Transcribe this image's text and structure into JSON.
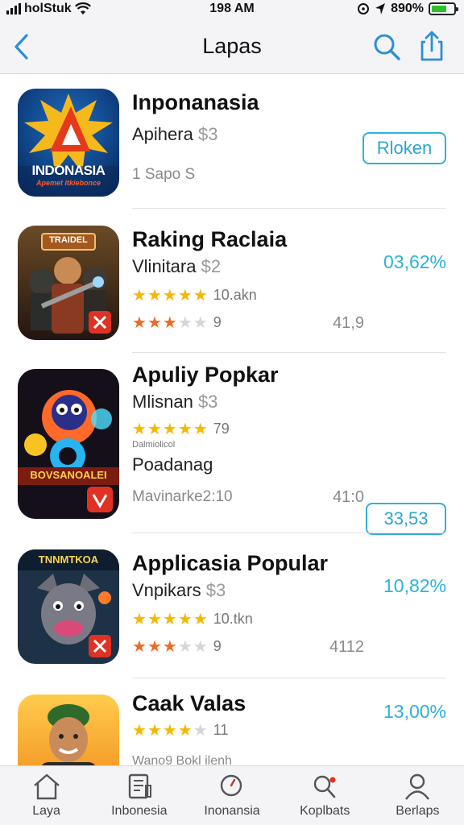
{
  "status_bar": {
    "carrier": "holStuk",
    "time": "198 AM",
    "battery": "890%",
    "battery_level_percent": 70
  },
  "nav": {
    "title": "Lapas"
  },
  "apps": [
    {
      "name": "Inponanasia",
      "subtitle": "Apihera",
      "price": "$3",
      "meta": "1 Sapo S",
      "button_label": "Rloken",
      "icon_text": "INDONASIA",
      "icon_subtext": "Apemet itkiebonce",
      "icon_colors": [
        "#0b4c9a",
        "#e43a1b",
        "#f6c323"
      ]
    },
    {
      "name": "Raking Raclaia",
      "subtitle": "Vlinitara",
      "price": "$2",
      "stars_yellow": {
        "filled": 5,
        "count_label": "10.akn"
      },
      "stars_red": {
        "filled": 3,
        "count_label": "9"
      },
      "right_value": "03,62%",
      "small_value": "41,9",
      "icon_text": "TRAIDEL",
      "icon_colors": [
        "#3b2a1a",
        "#c3782a",
        "#e03224"
      ]
    },
    {
      "name": "Apuliy Popkar",
      "subtitle": "Mlisnan",
      "price": "$3",
      "stars_yellow": {
        "filled": 5,
        "count_label": "79"
      },
      "tiny_text": "Dalmiolicol",
      "secondary_text": "Poadanag",
      "meta": "Mavinarke2:10",
      "button_label": "33,53",
      "small_value": "41:0",
      "icon_text": "BOVSANOALEI",
      "icon_colors": [
        "#150f1a",
        "#ff5b2a",
        "#27b4f0",
        "#f6c323"
      ]
    },
    {
      "name": "Applicasia Popular",
      "subtitle": "Vnpikars",
      "price": "$3",
      "stars_yellow": {
        "filled": 5,
        "count_label": "10.tkn"
      },
      "stars_red": {
        "filled": 3,
        "count_label": "9"
      },
      "right_value": "10,82%",
      "small_value": "4112",
      "icon_text": "TNNMTKOA",
      "icon_colors": [
        "#1d3246",
        "#7a7a86",
        "#e03224"
      ]
    },
    {
      "name": "Caak Valas",
      "stars_yellow": {
        "filled": 4,
        "count_label": "11"
      },
      "meta": "Wano9 Bokl ilenh",
      "right_value": "13,00%",
      "icon_colors": [
        "#f08a1a",
        "#ffcc4d",
        "#2e6b2a"
      ]
    }
  ],
  "tabs": [
    {
      "label": "Laya",
      "icon": "house-icon"
    },
    {
      "label": "Inbonesia",
      "icon": "document-icon"
    },
    {
      "label": "Inonansia",
      "icon": "search-icon"
    },
    {
      "label": "Koplbats",
      "icon": "search-badge-icon"
    },
    {
      "label": "Berlaps",
      "icon": "person-icon"
    }
  ],
  "colors": {
    "accent": "#2aa6cc",
    "star": "#f5b800",
    "star_red": "#f06a24"
  }
}
